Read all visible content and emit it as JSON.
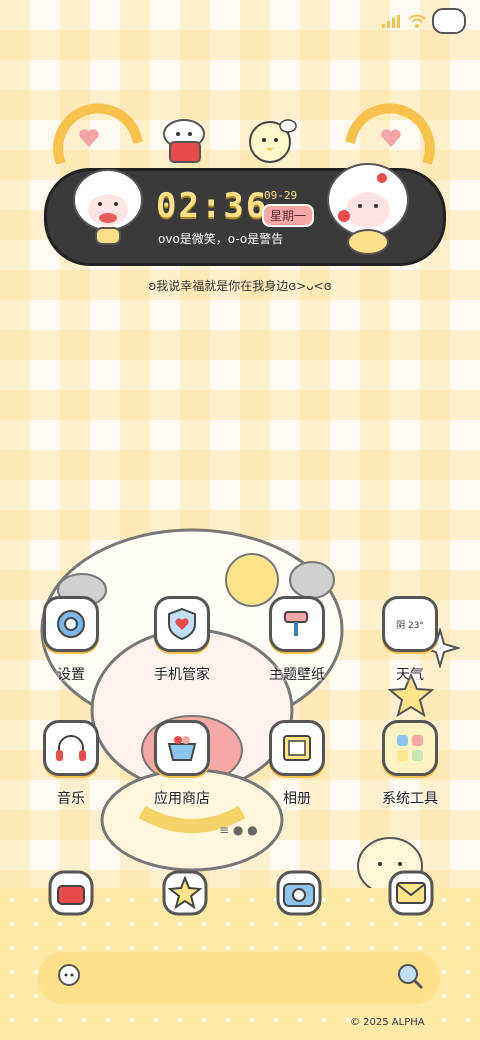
{
  "widget": {
    "time": "02:36",
    "date": "09-29",
    "weekday": "星期一",
    "subtitle": "ovo是微笑，o-o是警告"
  },
  "motto": "ʚ我说幸福就是你在我身边ɞ>ᴗ<ɞ",
  "apps_row1": [
    {
      "label": "设置",
      "icon": "gear-icon"
    },
    {
      "label": "手机管家",
      "icon": "shield-heart-icon"
    },
    {
      "label": "主题壁纸",
      "icon": "paint-roller-icon"
    },
    {
      "label": "天气",
      "icon": "weather-cloud-icon",
      "badge": "阴 23°"
    }
  ],
  "apps_row2": [
    {
      "label": "音乐",
      "icon": "headphones-icon"
    },
    {
      "label": "应用商店",
      "icon": "basket-icon"
    },
    {
      "label": "相册",
      "icon": "photo-frame-icon"
    },
    {
      "label": "系统工具",
      "icon": "folder-icon"
    }
  ],
  "dock": [
    {
      "icon": "telephone-icon"
    },
    {
      "icon": "star-chat-icon"
    },
    {
      "icon": "cat-camera-icon"
    },
    {
      "icon": "envelope-icon"
    }
  ],
  "copyright": "© 2025 ALPHA",
  "colors": {
    "accent": "#f6c24b",
    "widget_bg": "#3a3a3a",
    "time": "#ffe08a"
  }
}
